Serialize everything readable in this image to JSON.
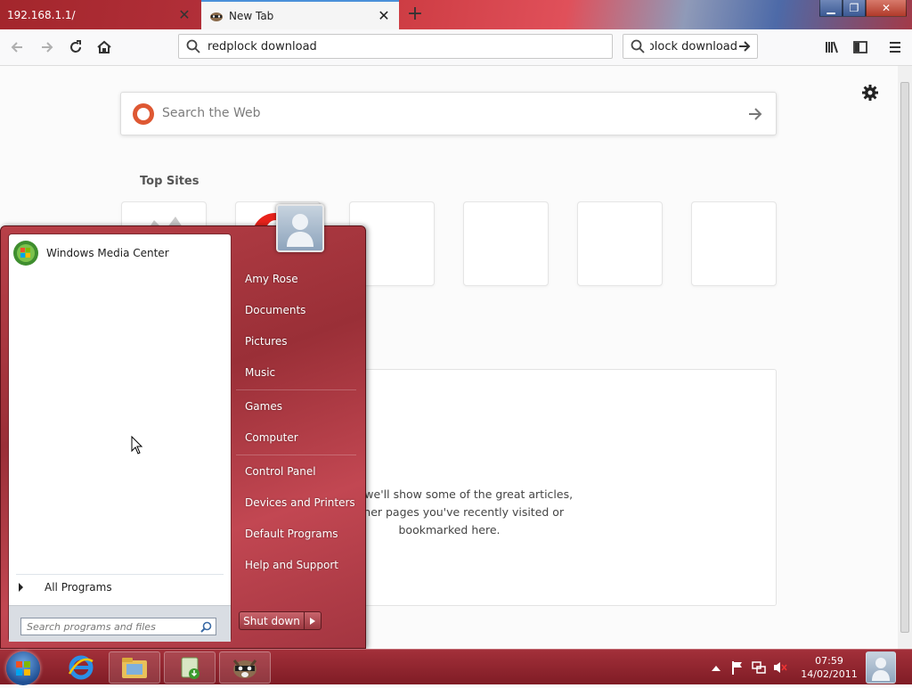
{
  "tabs": [
    {
      "title": "192.168.1.1/",
      "active": false
    },
    {
      "title": "New Tab",
      "active": true
    }
  ],
  "navbar": {
    "url": "redplock download",
    "search_value": "redplock download"
  },
  "newtab": {
    "search_placeholder": "Search the Web",
    "top_sites_label": "Top Sites",
    "highlights_line1": "g, and we'll show some of the great articles,",
    "highlights_line2": "nd other pages you've recently visited or",
    "highlights_line3": "bookmarked here."
  },
  "start_menu": {
    "pinned": [
      {
        "label": "Windows Media Center",
        "icon": "windows-media-center-icon"
      }
    ],
    "all_programs_label": "All Programs",
    "search_placeholder": "Search programs and files",
    "right_items": [
      {
        "label": "Amy Rose"
      },
      {
        "label": "Documents"
      },
      {
        "label": "Pictures"
      },
      {
        "label": "Music"
      },
      {
        "label": "Games"
      },
      {
        "label": "Computer"
      },
      {
        "label": "Control Panel"
      },
      {
        "label": "Devices and Printers"
      },
      {
        "label": "Default Programs"
      },
      {
        "label": "Help and Support"
      }
    ],
    "shutdown_label": "Shut down"
  },
  "taskbar": {
    "items": [
      "internet-explorer-icon",
      "windows-explorer-icon",
      "recycle-download-icon",
      "raccoon-browser-icon"
    ],
    "tray_icons": [
      "show-hidden-icons-arrow",
      "action-center-flag-icon",
      "network-icon",
      "volume-muted-icon"
    ],
    "time": "07:59",
    "date": "14/02/2011"
  },
  "colors": {
    "accent": "#4a90d9",
    "taskbar": "#8f2630",
    "start_menu": "#a8363f"
  }
}
